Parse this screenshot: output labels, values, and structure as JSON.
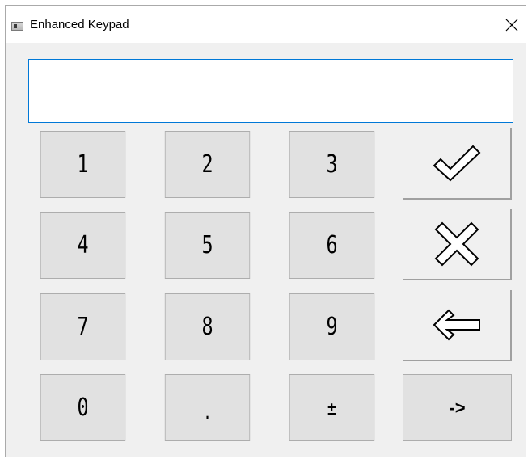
{
  "window": {
    "title": "Enhanced Keypad"
  },
  "display": {
    "value": ""
  },
  "keys": {
    "k1": "1",
    "k2": "2",
    "k3": "3",
    "k4": "4",
    "k5": "5",
    "k6": "6",
    "k7": "7",
    "k8": "8",
    "k9": "9",
    "k0": "0",
    "decimal": ".",
    "plus_minus": "±",
    "next": "->"
  },
  "actions": {
    "ok_icon": "checkmark-icon",
    "cancel_icon": "x-icon",
    "backspace_icon": "left-arrow-icon"
  },
  "colors": {
    "focus_border": "#0078d7",
    "key_face": "#e1e1e1",
    "window_bg": "#f0f0f0"
  }
}
